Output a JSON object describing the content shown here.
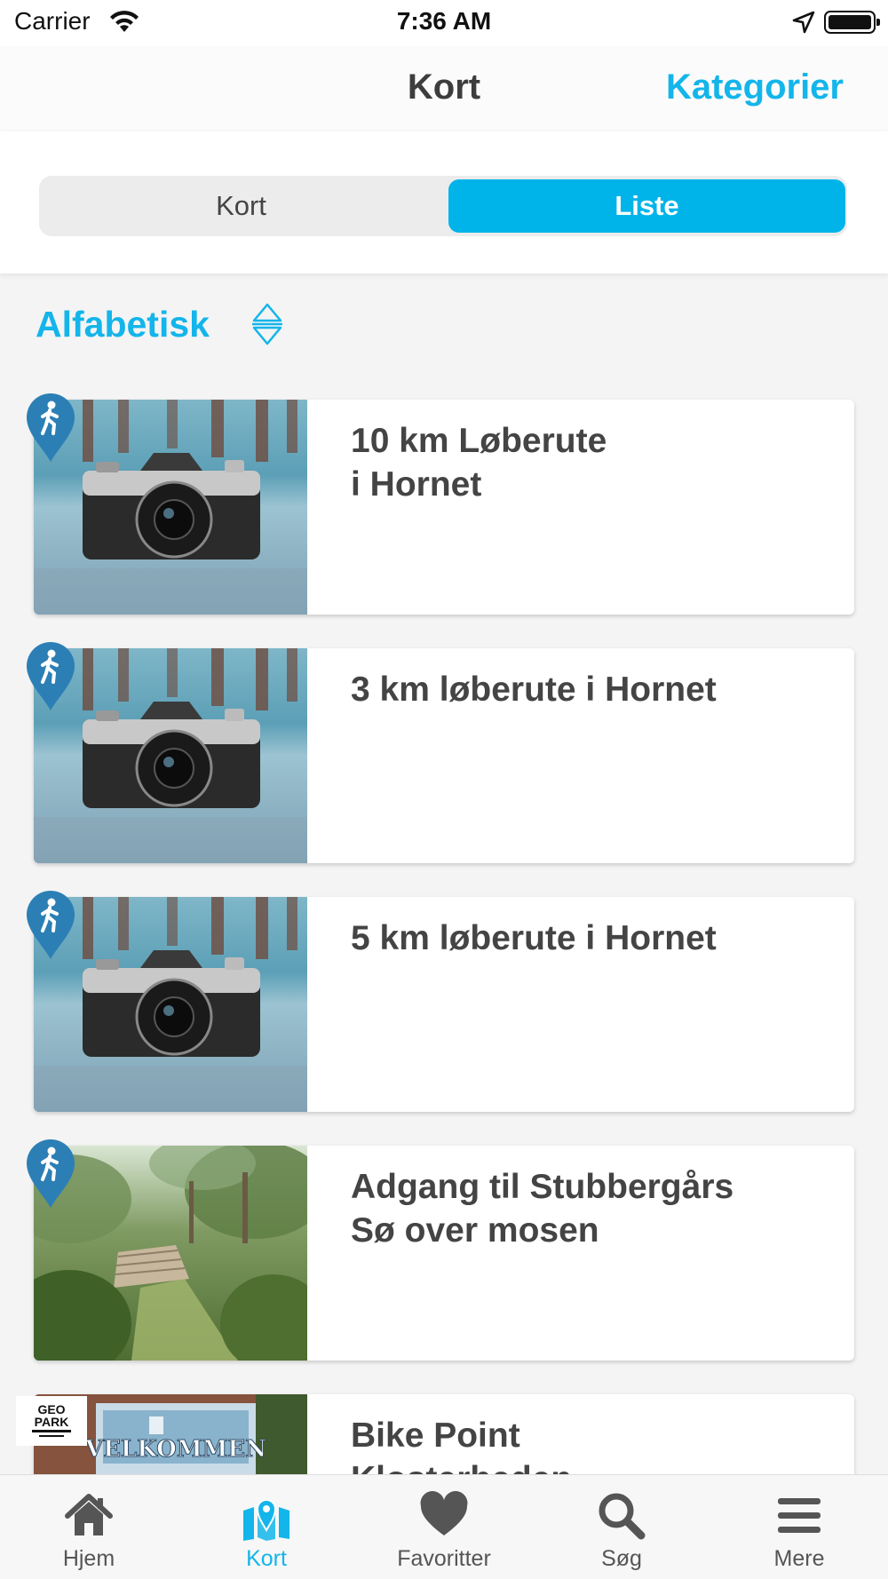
{
  "status_bar": {
    "carrier": "Carrier",
    "time": "7:36 AM"
  },
  "nav": {
    "title": "Kort",
    "right_button": "Kategorier"
  },
  "segments": [
    {
      "label": "Kort",
      "selected": false
    },
    {
      "label": "Liste",
      "selected": true
    }
  ],
  "sort": {
    "label": "Alfabetisk",
    "icon": "sort-updown-icon"
  },
  "list": [
    {
      "title": "10 km Løberute\ni Hornet",
      "image": "camera-on-beach",
      "category_icon": "walking-person-icon"
    },
    {
      "title": "3 km løberute i Hornet",
      "image": "camera-on-beach",
      "category_icon": "walking-person-icon"
    },
    {
      "title": "5 km løberute i Hornet",
      "image": "camera-on-beach",
      "category_icon": "walking-person-icon"
    },
    {
      "title": "Adgang til Stubbergårs\nSø over mosen",
      "image": "path-through-bushes",
      "category_icon": "walking-person-icon"
    },
    {
      "title": "Bike Point\nKlosterheden",
      "image": "welcome-sign",
      "category_icon": "geopark-logo"
    }
  ],
  "tabs": [
    {
      "label": "Hjem",
      "icon": "home-icon",
      "active": false
    },
    {
      "label": "Kort",
      "icon": "map-icon",
      "active": true
    },
    {
      "label": "Favoritter",
      "icon": "heart-icon",
      "active": false
    },
    {
      "label": "Søg",
      "icon": "search-icon",
      "active": false
    },
    {
      "label": "Mere",
      "icon": "menu-icon",
      "active": false
    }
  ],
  "colors": {
    "accent": "#13b5ea",
    "pin": "#2b7fb5",
    "text": "#444444",
    "background": "#f4f4f4"
  }
}
